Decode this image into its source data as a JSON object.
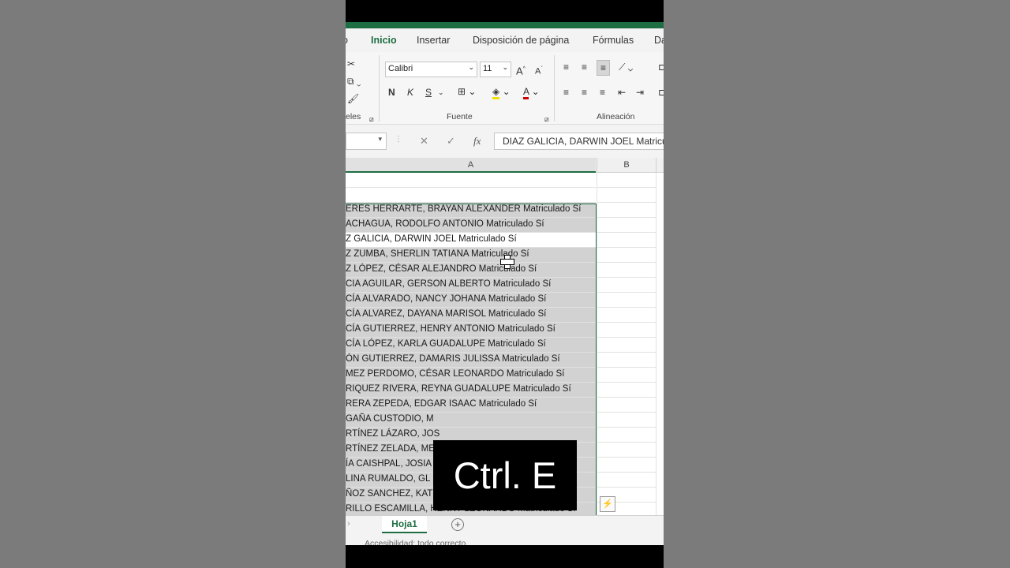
{
  "ribbon_tabs": [
    "Inicio",
    "Insertar",
    "Disposición de página",
    "Fórmulas",
    "Da"
  ],
  "active_tab": "Inicio",
  "ribbon": {
    "font_name": "Calibri",
    "font_size": "11",
    "clipboard_label": "eles",
    "font_group_label": "Fuente",
    "align_group_label": "Alineación",
    "bold_label": "N",
    "italic_label": "K",
    "underline_label": "S"
  },
  "formula_bar": {
    "value": "DIAZ GALICIA, DARWIN JOEL Matriculado Sí",
    "fx_label": "fx"
  },
  "columns": [
    "A",
    "B"
  ],
  "rows": [
    "",
    "",
    "ERES HERRARTE, BRAYAN ALEXANDER Matriculado Sí",
    "ACHAGUA, RODOLFO ANTONIO Matriculado Sí",
    "Z GALICIA, DARWIN JOEL Matriculado Sí",
    "Z ZUMBA, SHERLIN TATIANA Matriculado Sí",
    "Z LÓPEZ, CÉSAR ALEJANDRO Matriculado Sí",
    "CIA AGUILAR, GERSON ALBERTO Matriculado Sí",
    "CÍA ALVARADO, NANCY JOHANA Matriculado Sí",
    "CÍA ALVAREZ, DAYANA MARISOL Matriculado Sí",
    "CÍA GUTIERREZ, HENRY ANTONIO Matriculado Sí",
    "CÍA LÓPEZ, KARLA GUADALUPE Matriculado Sí",
    "ÓN GUTIERREZ, DAMARIS JULISSA Matriculado Sí",
    "MEZ PERDOMO, CÉSAR LEONARDO Matriculado Sí",
    "RIQUEZ RIVERA, REYNA GUADALUPE Matriculado Sí",
    "RERA ZEPEDA, EDGAR ISAAC Matriculado Sí",
    "GAÑA CUSTODIO, M",
    "RTÍNEZ LÁZARO, JOS",
    "RTÍNEZ ZELADA, ME                                        Sí",
    "ÍA CAISHPAL, JOSIA",
    "LINA RUMALDO, GL",
    "ÑOZ SANCHEZ, KATYA MICHELLE Matriculado Sí",
    "RILLO ESCAMILLA, HENRY LEONARDO Matriculado Sí"
  ],
  "sheet_tab": "Hoja1",
  "status_text": "Accesibilidad: todo correcto",
  "overlay_text": "Ctrl. E"
}
